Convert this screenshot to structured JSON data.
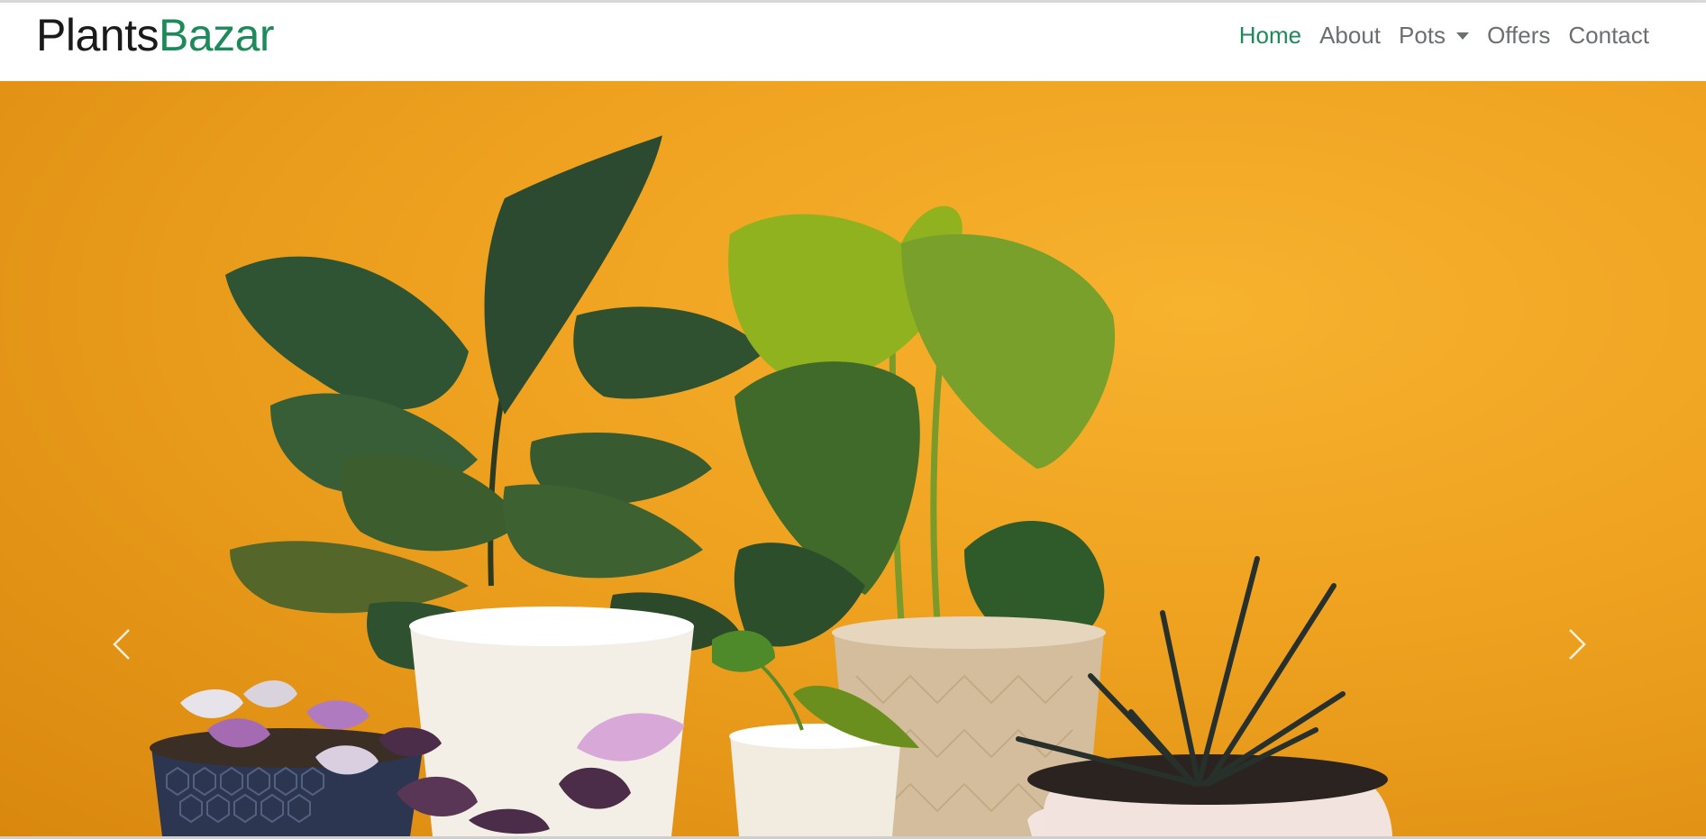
{
  "brand": {
    "part1": "Plants",
    "part2": "Bazar",
    "accent_color": "#1e8a5a"
  },
  "nav": {
    "items": [
      {
        "label": "Home",
        "active": true
      },
      {
        "label": "About"
      },
      {
        "label": "Pots",
        "dropdown": true
      },
      {
        "label": "Offers"
      },
      {
        "label": "Contact"
      }
    ]
  },
  "carousel": {
    "prev_icon": "chevron-left-icon",
    "next_icon": "chevron-right-icon",
    "background_color": "#f0a323"
  }
}
